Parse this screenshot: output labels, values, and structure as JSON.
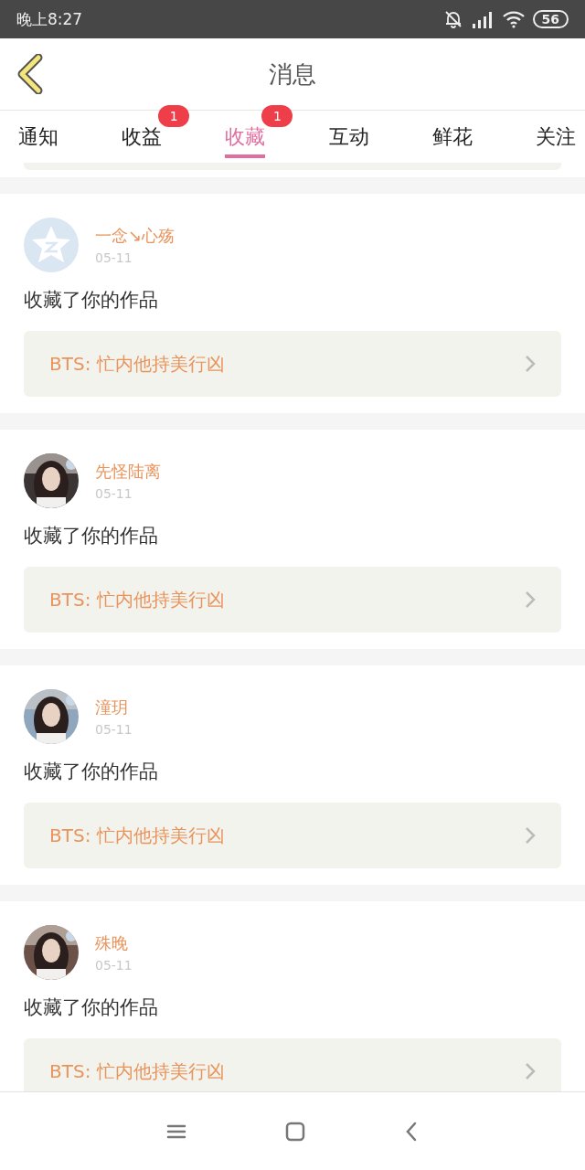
{
  "status_bar": {
    "time": "晚上8:27",
    "battery": "56"
  },
  "header": {
    "title": "消息"
  },
  "tabs": [
    {
      "label": "通知",
      "selected": false
    },
    {
      "label": "收益",
      "selected": false,
      "badge": "1"
    },
    {
      "label": "收藏",
      "selected": true,
      "badge": "1"
    },
    {
      "label": "互动",
      "selected": false
    },
    {
      "label": "鲜花",
      "selected": false
    },
    {
      "label": "关注",
      "selected": false
    }
  ],
  "messages": [
    {
      "kind": "default",
      "user": "一念↘心殇",
      "date": "05-11",
      "action": "收藏了你的作品",
      "work": "BTS: 忙内他持美行凶"
    },
    {
      "kind": "picture",
      "user": "先怪陆离",
      "date": "05-11",
      "action": "收藏了你的作品",
      "work": "BTS: 忙内他持美行凶"
    },
    {
      "kind": "picture",
      "user": "潼玥",
      "date": "05-11",
      "action": "收藏了你的作品",
      "work": "BTS: 忙内他持美行凶"
    },
    {
      "kind": "picture",
      "user": "殊晚",
      "date": "05-11",
      "action": "收藏了你的作品",
      "work": "BTS: 忙内他持美行凶"
    }
  ]
}
